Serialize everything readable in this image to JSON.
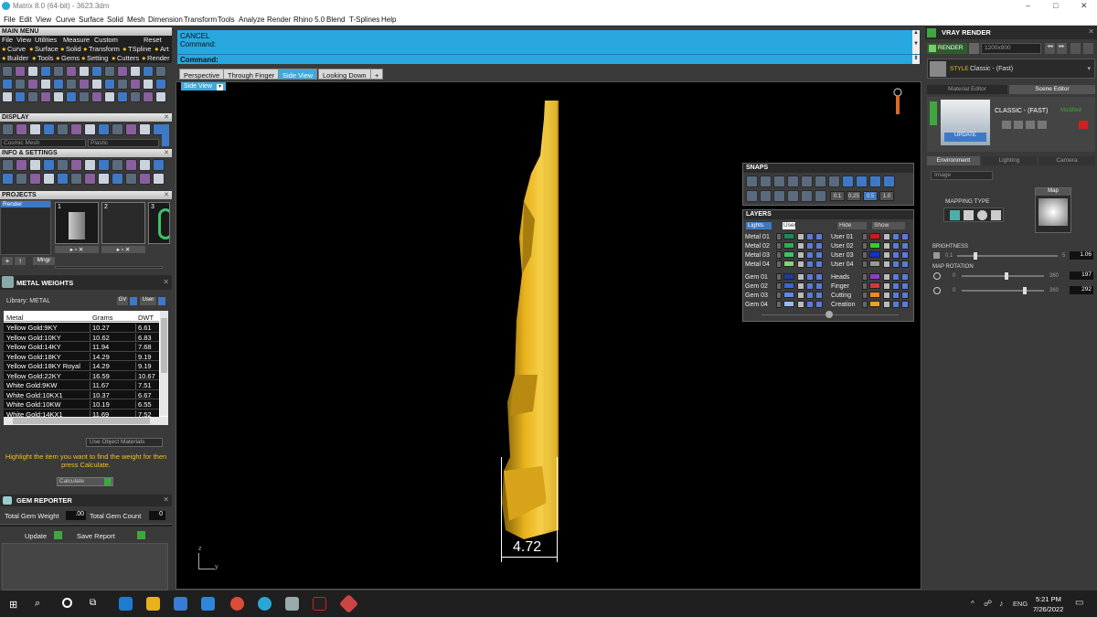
{
  "title": "Matrix 8.0 (64-bit) - 3623.3dm",
  "window_controls": [
    "–",
    "□",
    "✕"
  ],
  "menubar": [
    "File",
    "Edit",
    "View",
    "Curve",
    "Surface",
    "Solid",
    "Mesh",
    "Dimension",
    "Transform",
    "Tools",
    "Analyze",
    "Render",
    "Rhino 5.0",
    "Blend",
    "T-Splines",
    "Help"
  ],
  "left": {
    "main_menu_title": "MAIN MENU",
    "main_menu_row1": [
      "File",
      "View",
      "Utilities",
      "Measure",
      "Custom",
      "Reset"
    ],
    "main_menu_row2": [
      "Curve",
      "Surface",
      "Solid",
      "Transform",
      "TSpline",
      "Art"
    ],
    "main_menu_row3": [
      "Builder",
      "Tools",
      "Gems",
      "Setting",
      "Cutters",
      "Render"
    ],
    "display_title": "DISPLAY",
    "display_select1": "Cosmic Mesh",
    "display_select2": "Plastic",
    "info_title": "INFO & SETTINGS",
    "projects_title": "PROJECTS",
    "project_item": "Render",
    "project_slots": [
      "1",
      "2",
      "3"
    ],
    "project_mngr": "Mngr",
    "metal_weights_title": "METAL WEIGHTS",
    "library_label": "Library: METAL",
    "library_btns": [
      "GV",
      "User"
    ],
    "mw_headers": [
      "Metal",
      "Grams",
      "DWT"
    ],
    "mw_rows": [
      [
        "Yellow Gold:9KY",
        "10.27",
        "6.61"
      ],
      [
        "Yellow Gold:10KY",
        "10.62",
        "6.83"
      ],
      [
        "Yellow Gold:14KY",
        "11.94",
        "7.68"
      ],
      [
        "Yellow Gold:18KY",
        "14.29",
        "9.19"
      ],
      [
        "Yellow Gold:18KY Royal",
        "14.29",
        "9.19"
      ],
      [
        "Yellow Gold:22KY",
        "16.59",
        "10.67"
      ],
      [
        "White Gold:9KW",
        "11.67",
        "7.51"
      ],
      [
        "White Gold:10KX1",
        "10.37",
        "6.67"
      ],
      [
        "White Gold:10KW",
        "10.19",
        "6.55"
      ],
      [
        "White Gold:14KX1",
        "11.69",
        "7.52"
      ]
    ],
    "use_object_materials": "Use Object Materials",
    "highlight_text": "Highlight the item you want to find the weight for then press Calculate.",
    "calculate": "Calculate",
    "gem_reporter_title": "GEM REPORTER",
    "total_gem_weight": "Total Gem Weight",
    "total_gem_weight_val": ".00",
    "total_gem_count": "Total Gem Count",
    "total_gem_count_val": "0",
    "update": "Update",
    "save_report": "Save Report"
  },
  "command": {
    "cancel": "CANCEL",
    "line1": "Command:",
    "line2": "Command:"
  },
  "tabs": [
    "Perspective",
    "Through Finger",
    "Side View",
    "Looking Down",
    "+"
  ],
  "active_tab": "Side View",
  "view_label": "Side View",
  "dimension": "4.72",
  "axis": {
    "z": "z",
    "y": "y"
  },
  "snaps": {
    "title": "SNAPS",
    "values": [
      "0.1",
      "0.25",
      "0.5",
      "1.0"
    ]
  },
  "layers": {
    "title": "LAYERS",
    "lights": "Lights",
    "user": "User",
    "hide": "Hide",
    "show": "Show",
    "left_rows": [
      {
        "name": "Metal 01",
        "color": "#1b8a5a"
      },
      {
        "name": "Metal 02",
        "color": "#2fae55"
      },
      {
        "name": "Metal 03",
        "color": "#3ec26a"
      },
      {
        "name": "Metal 04",
        "color": "#7ed77e"
      },
      {
        "name": "Gem 01",
        "color": "#1f3aa0"
      },
      {
        "name": "Gem 02",
        "color": "#3a66d6"
      },
      {
        "name": "Gem 03",
        "color": "#5b8be3"
      },
      {
        "name": "Gem 04",
        "color": "#9bb9ee"
      }
    ],
    "right_rows": [
      {
        "name": "User 01",
        "color": "#d01818"
      },
      {
        "name": "User 02",
        "color": "#2ed02e"
      },
      {
        "name": "User 03",
        "color": "#1133cc"
      },
      {
        "name": "User 04",
        "color": "#9a9a9a"
      },
      {
        "name": "Heads",
        "color": "#8a3fc8"
      },
      {
        "name": "Finger",
        "color": "#d23a3a"
      },
      {
        "name": "Cutting",
        "color": "#f08a1a"
      },
      {
        "name": "Creation",
        "color": "#f0a020"
      }
    ]
  },
  "vray": {
    "title": "VRAY RENDER",
    "render_btn": "RENDER",
    "resolution": "1200x900",
    "style_label": "STYLE",
    "style_value": "Classic - (Fast)",
    "tab_material": "Material Editor",
    "tab_scene": "Scene Editor",
    "preset_name": "CLASSIC - (FAST)",
    "preset_state": "Modified",
    "update": "UPDATE",
    "env_tabs": [
      "Environment",
      "Lighting",
      "Camera"
    ],
    "env_select": "Image",
    "mapping_type": "MAPPING TYPE",
    "map_label": "Map",
    "brightness": "BRIGHTNESS",
    "brightness_min": "0.1",
    "brightness_max": "5",
    "brightness_val": "1.06",
    "map_rotation": "MAP ROTATION",
    "rot1_min": "0",
    "rot1_max": "360",
    "rot1_val": "197",
    "rot2_min": "0",
    "rot2_max": "360",
    "rot2_val": "292"
  },
  "taskbar": {
    "lang": "ENG",
    "time": "5:21 PM",
    "date": "7/26/2022"
  },
  "colors": {
    "accent_blue": "#29a8e0",
    "gold": "#e8b21c",
    "panel_bg": "#3a3a3a"
  }
}
